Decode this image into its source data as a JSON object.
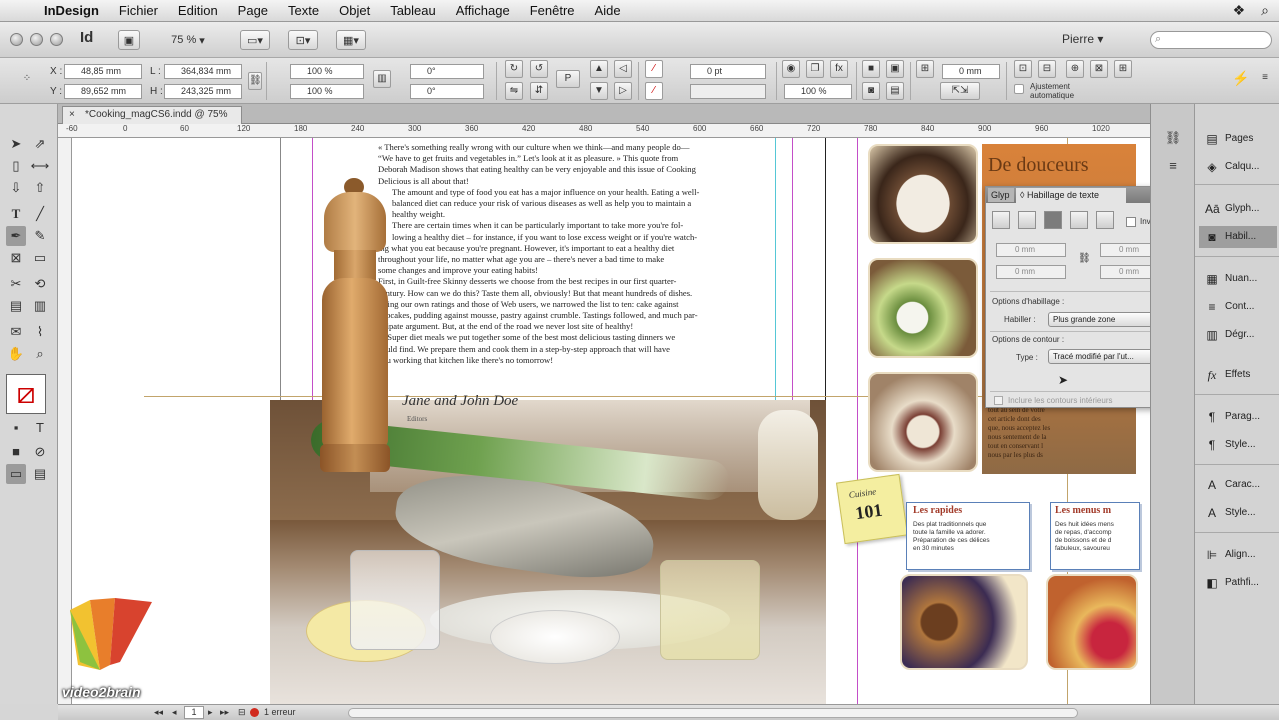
{
  "menubar": {
    "app": "InDesign",
    "items": [
      "Fichier",
      "Edition",
      "Page",
      "Texte",
      "Objet",
      "Tableau",
      "Affichage",
      "Fenêtre",
      "Aide"
    ]
  },
  "appbar": {
    "logo": "Id",
    "zoom": "75 %",
    "workspace": "Pierre"
  },
  "controlbar": {
    "x_value": "48,85 mm",
    "y_value": "89,652 mm",
    "w_value": "364,834 mm",
    "h_value": "243,325 mm",
    "scale_x": "100 %",
    "scale_y": "100 %",
    "angle": "0°",
    "shear": "0°",
    "stroke_weight": "0 pt",
    "opacity": "100 %",
    "offset": "0 mm",
    "auto_fit": "Ajustement automatique"
  },
  "document": {
    "tab_title": "*Cooking_magCS6.indd @ 75%",
    "ruler_labels": [
      "-60",
      "0",
      "60",
      "120",
      "180",
      "240",
      "300",
      "360",
      "420",
      "480",
      "540",
      "600",
      "660",
      "720",
      "780",
      "840",
      "900",
      "960",
      "1020"
    ]
  },
  "article": {
    "lines": [
      "« There's something really wrong with our culture when we think—and many people do—",
      "“We have to get fruits and vegetables in.” Let's look at it as pleasure. » This quote from",
      "Deborah Madison shows that eating healthy can be very enjoyable and this issue of Cooking",
      "Delicious is all about that!",
      "The amount and type of food you eat has a major influence on your health. Eating a well-",
      "balanced diet can reduce your risk of various diseases as well as help you to maintain a",
      "healthy weight.",
      "There are certain times when it can be particularly important to take more you're fol-",
      "lowing a healthy diet – for instance, if you want to lose excess weight or if you're watch-",
      "ing what you eat because you're pregnant. However, it's important to eat a healthy diet",
      "throughout your life, no matter what age you are – there's never a bad time to make",
      "some changes and improve your eating habits!",
      "First, in Guilt-free Skinny desserts we choose from the best recipes in our first quarter-",
      "century. How can we do this? Taste them all, obviously! But that meant hundreds of dishes.",
      "Using our own ratings and those of Web users, we narrowed the list to ten: cake against",
      "cupcakes, pudding against mousse, pastry against crumble. Tastings followed, and much par-",
      "ticipate argument. But, at the end of the road we never lost site of healthy!",
      "In Super diet meals we put together some of the best most delicious tasting dinners we",
      "could find. We prepare them and cook them in a step-by-step approach that will have",
      "you working that kitchen like there's no tomorrow!"
    ],
    "byline": "Jane and John Doe",
    "byline_sub": "Editors"
  },
  "right_page": {
    "box_heading_1": "Les rapides",
    "box_text_1": [
      "Des plat traditionnels que",
      "toute la famille va adorer.",
      "Préparation de ces délices",
      "en 30 minutes"
    ],
    "box_heading_2": "Les menus m",
    "box_text_2": [
      "Des huit idées mens",
      "de repas, d'accomp",
      "de boissons et de d",
      "fabuleux, savoureu"
    ],
    "badge_line_1": "Cuisine",
    "badge_line_2": "101",
    "orange_heading": "De douceurs",
    "orange_text": [
      "tout au sein de votre",
      "cet article dont des",
      "que, nous acceptez les",
      "nous sentement de la",
      "tout en conservant l",
      "nous par les plus ds"
    ]
  },
  "wrap_panel": {
    "tab_short": "Glyp",
    "title": "Habillage de texte",
    "invert_label": "Inverser",
    "offset_top": "0 mm",
    "offset_bottom": "0 mm",
    "offset_left": "0 mm",
    "offset_right": "0 mm",
    "section_wrap": "Options d'habillage :",
    "wrap_label": "Habiller :",
    "wrap_value": "Plus grande zone",
    "section_contour": "Options de contour :",
    "type_label": "Type :",
    "type_value": "Tracé modifié par l'ut...",
    "inner_label": "Inclure les contours intérieurs"
  },
  "dock": {
    "items": [
      "Pages",
      "Calqu...",
      "Glyph...",
      "Habil...",
      "Nuan...",
      "Cont...",
      "Dégr...",
      "Effets",
      "Parag...",
      "Style...",
      "Carac...",
      "Style...",
      "Align...",
      "Pathfi..."
    ]
  },
  "statusbar": {
    "page": "1",
    "errors": "1 erreur"
  },
  "watermark": {
    "text": "video2brain"
  },
  "colors": {
    "accent_orange": "#d9823a",
    "guide_magenta": "#c34ec8",
    "guide_cyan": "#55c7d6"
  }
}
